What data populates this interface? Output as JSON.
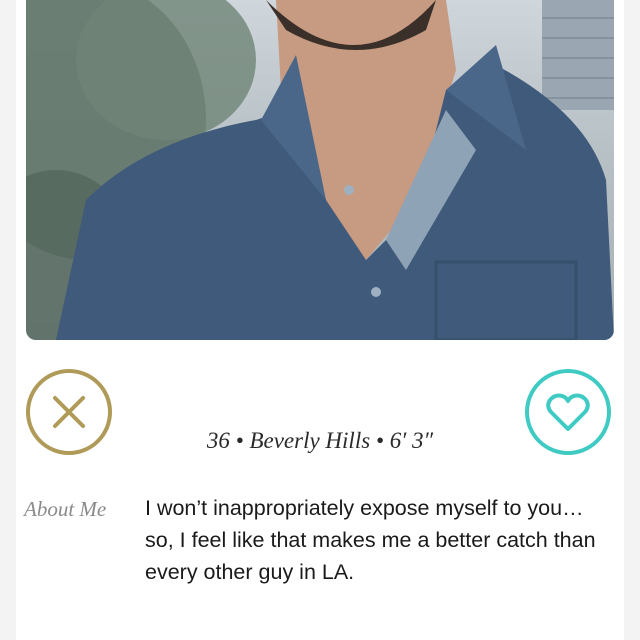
{
  "profile": {
    "age": "36",
    "location": "Beverly Hills",
    "height": "6′ 3″",
    "separator": "•"
  },
  "about": {
    "label": "About Me",
    "text": "I won’t inappropriately expose myself to you… so, I feel like that makes me a better catch than every other guy in LA."
  },
  "actions": {
    "pass_icon": "x-icon",
    "like_icon": "heart-icon"
  },
  "colors": {
    "pass": "#b09a57",
    "like": "#3fcbc3",
    "shirt": "#3f5a7a"
  }
}
